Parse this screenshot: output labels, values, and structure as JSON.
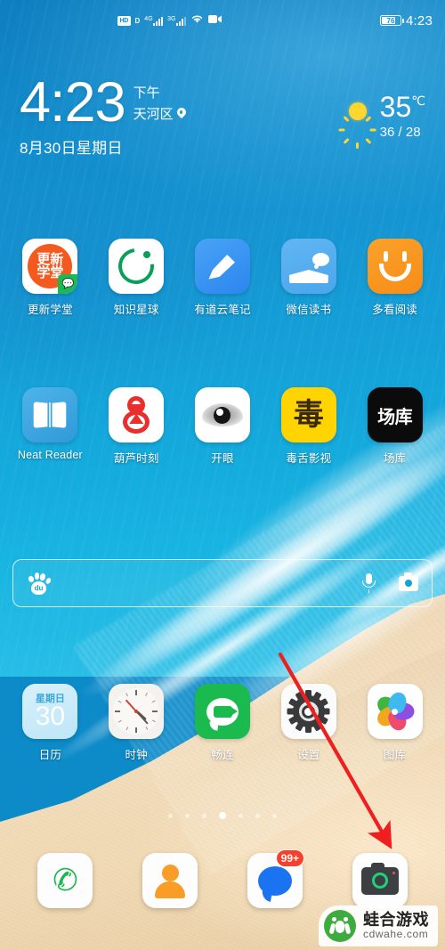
{
  "status_bar": {
    "hd_label": "HD",
    "hd_sub": "D",
    "net1": "4G",
    "net2": "3G",
    "wifi_icon": "wifi-icon",
    "video_icon": "video-recording-icon",
    "battery_percent": "76",
    "time": "4:23"
  },
  "widget": {
    "time": "4:23",
    "ampm": "下午",
    "location": "天河区",
    "location_icon": "location-pin-icon",
    "date": "8月30日星期日",
    "weather_icon": "sun-icon",
    "temperature": "35",
    "temp_unit": "℃",
    "high_low": "36 / 28"
  },
  "rows": [
    {
      "apps": [
        {
          "label": "更新学堂",
          "icon": "gengxin-xuetang-icon",
          "text": "更新\n学堂",
          "badge_icon": "wechat-badge-icon",
          "color": "#f4591f"
        },
        {
          "label": "知识星球",
          "icon": "zhishi-xingqiu-icon",
          "color": "#0aa05a"
        },
        {
          "label": "有道云笔记",
          "icon": "youdao-note-icon",
          "color": "#2b86ef"
        },
        {
          "label": "微信读书",
          "icon": "wechat-read-icon",
          "color": "#4aa6ec"
        },
        {
          "label": "多看阅读",
          "icon": "duokan-read-icon",
          "color": "#f68d17"
        }
      ]
    },
    {
      "apps": [
        {
          "label": "Neat Reader",
          "icon": "neat-reader-icon",
          "color": "#2f9ad8"
        },
        {
          "label": "葫芦时刻",
          "icon": "hulu-shike-icon",
          "color": "#ea2d2d"
        },
        {
          "label": "开眼",
          "icon": "kaiyan-icon",
          "color": "#151515"
        },
        {
          "label": "毒舌影视",
          "icon": "dushe-yingshi-icon",
          "text": "毒",
          "color": "#ffd400"
        },
        {
          "label": "场库",
          "icon": "changku-icon",
          "text": "场库",
          "color": "#0b0b0b"
        }
      ]
    },
    {
      "apps": [
        {
          "label": "日历",
          "icon": "calendar-icon",
          "week": "星期日",
          "day": "30",
          "color": "#39a8dd"
        },
        {
          "label": "时钟",
          "icon": "clock-icon",
          "color": "#d0412f"
        },
        {
          "label": "畅连",
          "icon": "changlian-icon",
          "color": "#1aba4e"
        },
        {
          "label": "设置",
          "icon": "settings-gear-icon",
          "color": "#3a3a3a"
        },
        {
          "label": "图库",
          "icon": "gallery-icon",
          "color": "#ff7a1a"
        }
      ]
    }
  ],
  "search": {
    "brand_icon": "baidu-paw-icon",
    "brand_text": "du",
    "placeholder": "",
    "mic_icon": "microphone-icon",
    "camera_icon": "camera-search-icon"
  },
  "page_dots": {
    "count": 7,
    "active_index": 3
  },
  "dock": [
    {
      "label": "Phone",
      "icon": "phone-icon",
      "glyph": "✆",
      "color": "#19b74e"
    },
    {
      "label": "Contacts",
      "icon": "contacts-icon",
      "color": "#fa9d27"
    },
    {
      "label": "Messages",
      "icon": "messages-icon",
      "badge": "99+",
      "color": "#1a73f0"
    },
    {
      "label": "Camera",
      "icon": "camera-icon",
      "color": "#21d07a"
    }
  ],
  "annotation": {
    "type": "red-arrow",
    "points_to": "camera-icon",
    "color": "#f01f1f"
  },
  "watermark": {
    "name": "蛙合游戏",
    "url": "cdwahe.com",
    "logo_icon": "frog-logo-icon",
    "color": "#3faa3f"
  }
}
